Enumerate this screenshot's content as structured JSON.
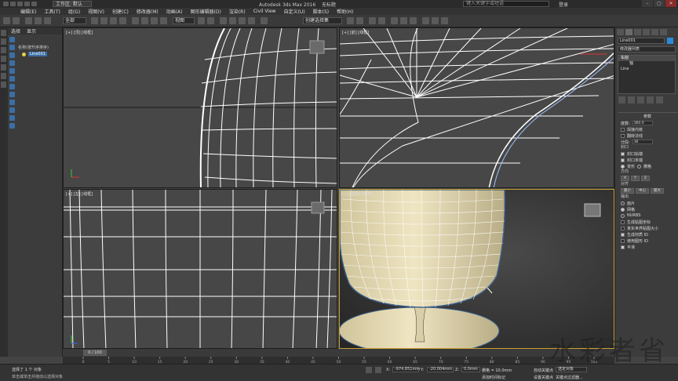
{
  "title_bar": {
    "workspace": "工作区: 默认",
    "app_title": "Autodesk 3ds Max 2016",
    "doc_title": "无标题",
    "search_placeholder": "键入关键字或短语",
    "login": "登录"
  },
  "menu": [
    "编辑(E)",
    "工具(T)",
    "组(G)",
    "视图(V)",
    "创建(C)",
    "修改器(M)",
    "动画(A)",
    "图形编辑器(D)",
    "渲染(R)",
    "Civil View",
    "自定义(U)",
    "脚本(S)",
    "帮助(H)"
  ],
  "toolbar": {
    "filter_select": "全部",
    "view_select": "视图",
    "named_sel": "创建选择集"
  },
  "scene_explorer": {
    "tabs": [
      "选择",
      "显示"
    ],
    "header": "名称(按升序排序)",
    "object_name": "Line001"
  },
  "viewports": {
    "top_left": "[+] [顶] [线框]",
    "top_right": "[+] [前] [线框]",
    "bottom_left": "[+] [左] [线框]",
    "bottom_right": "[+] [透视] [真实]"
  },
  "command_panel": {
    "object_name": "Line001",
    "modifier_list": "修改器列表",
    "stack": [
      "车削",
      "轴",
      "Line"
    ],
    "rollout_title": "参数",
    "degrees_label": "度数:",
    "degrees_value": "360.0",
    "weld_core": "焊接内核",
    "flip_normals": "翻转法线",
    "segments_label": "分段:",
    "segments_value": "36",
    "capping_title": "封口",
    "cap_start": "封口始端",
    "cap_end": "封口末端",
    "morph": "变形",
    "grid": "栅格",
    "direction_title": "方向",
    "dir_buttons": [
      "X",
      "Y",
      "Z"
    ],
    "align_title": "对齐",
    "align_buttons": [
      "最小",
      "中心",
      "最大"
    ],
    "output_title": "输出",
    "out_patch": "面片",
    "out_mesh": "网格",
    "out_nurbs": "NURBS",
    "gen_map": "生成贴图坐标",
    "real_world": "真实世界贴图大小",
    "gen_mat": "生成材质 ID",
    "use_shape": "使用图形 ID",
    "smooth": "平滑"
  },
  "timeline": {
    "slider": "0 / 100",
    "ticks": [
      "0",
      "5",
      "10",
      "15",
      "20",
      "25",
      "30",
      "35",
      "40",
      "45",
      "50",
      "55",
      "60",
      "65",
      "70",
      "75",
      "80",
      "85",
      "90",
      "95",
      "100"
    ]
  },
  "status": {
    "line1": "选择了 1 个 对象",
    "line2": "单击或单击并拖动以选择对象",
    "x_label": "X:",
    "x_value": "-974.851mm",
    "y_label": "Y:",
    "y_value": "-20.004mm",
    "z_label": "Z:",
    "z_value": "0.0mm",
    "grid": "栅格 = 10.0mm",
    "add_time_tag": "添加时间标记",
    "auto_key": "自动关键点",
    "set_key": "设置关键点",
    "selected": "选定对象",
    "key_filters": "关键点过滤器..."
  },
  "colors": {
    "viewport_bg": "#474747",
    "wire": "#f2f2f2",
    "selection_blue": "#3b6ea5",
    "shell": "#e6dcb4",
    "active_border": "#c8a030"
  },
  "watermark": "水彩者省"
}
